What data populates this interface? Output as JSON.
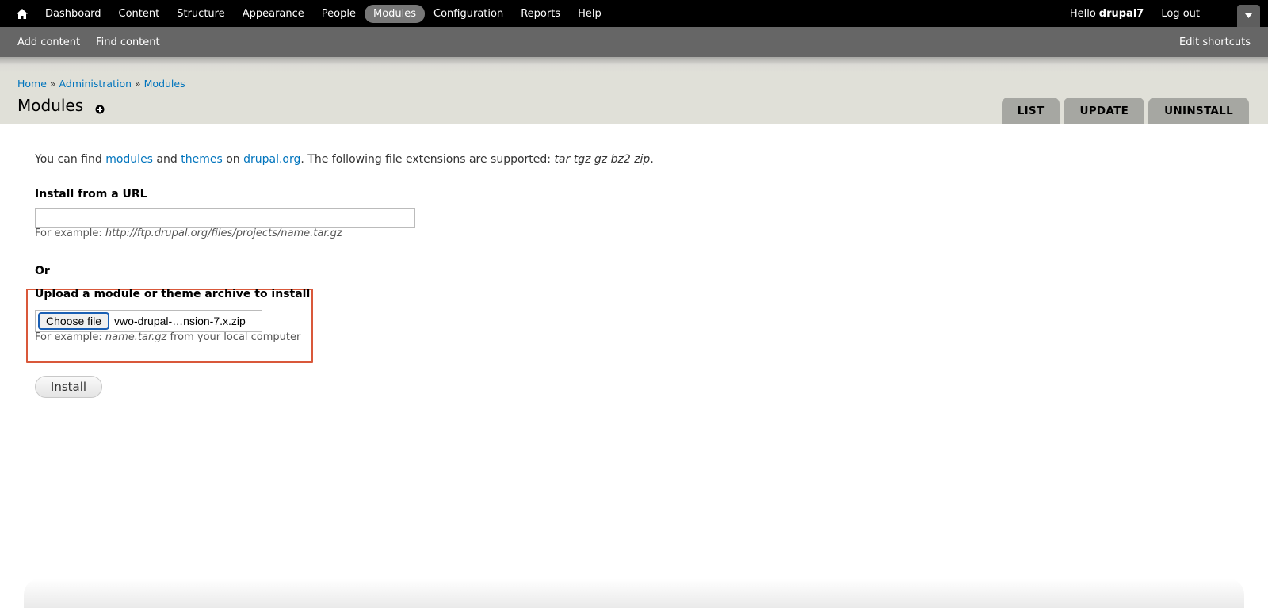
{
  "toolbar": {
    "home_icon": "home-icon",
    "menu": [
      {
        "label": "Dashboard"
      },
      {
        "label": "Content"
      },
      {
        "label": "Structure"
      },
      {
        "label": "Appearance"
      },
      {
        "label": "People"
      },
      {
        "label": "Modules",
        "active": true
      },
      {
        "label": "Configuration"
      },
      {
        "label": "Reports"
      },
      {
        "label": "Help"
      }
    ],
    "greeting": "Hello",
    "username": "drupal7",
    "logout": "Log out",
    "toggle_icon": "caret-down-icon"
  },
  "shortcuts": {
    "links": [
      "Add content",
      "Find content"
    ],
    "edit": "Edit shortcuts"
  },
  "breadcrumb": {
    "items": [
      "Home",
      "Administration",
      "Modules"
    ],
    "separator": "»"
  },
  "page": {
    "title": "Modules",
    "add_shortcut_icon": "plus-circle-icon"
  },
  "tabs": [
    "LIST",
    "UPDATE",
    "UNINSTALL"
  ],
  "intro": {
    "text_1": "You can find ",
    "link_modules": "modules",
    "text_2": " and ",
    "link_themes": "themes",
    "text_3": " on ",
    "link_drupal": "drupal.org",
    "text_4": ". The following file extensions are supported: ",
    "extensions": "tar tgz gz bz2 zip",
    "text_5": "."
  },
  "url_field": {
    "label": "Install from a URL",
    "value": "",
    "desc_prefix": "For example: ",
    "desc_example": "http://ftp.drupal.org/files/projects/name.tar.gz"
  },
  "or_label": "Or",
  "upload_field": {
    "label": "Upload a module or theme archive to install",
    "button": "Choose file",
    "file_name": "vwo-drupal-…nsion-7.x.zip",
    "desc_prefix": "For example: ",
    "desc_example": "name.tar.gz",
    "desc_suffix": " from your local computer"
  },
  "install_button": "Install",
  "colors": {
    "link": "#0074bd",
    "highlight_border": "#d9583a",
    "toolbar_bg": "#000000",
    "shortcuts_bg": "#666666",
    "tab_bg": "#a6a7a2"
  }
}
